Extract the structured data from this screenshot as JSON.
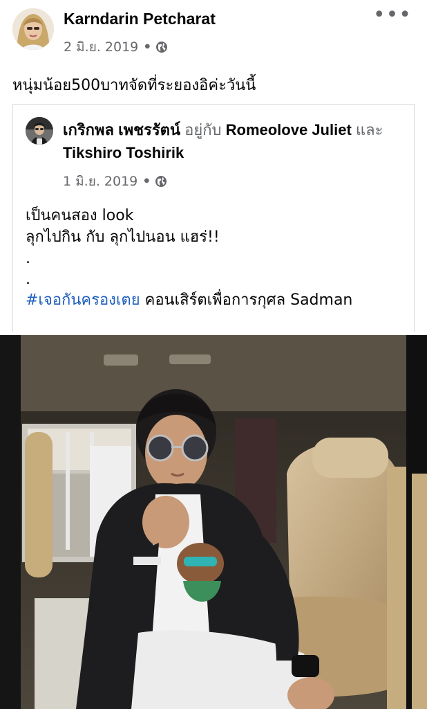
{
  "post": {
    "author": "Karndarin Petcharat",
    "date": "2 มิ.ย. 2019",
    "dot": "•",
    "caption": "หนุ่มน้อย500บาทจัดที่ระยองอิค่ะวันนี้",
    "more_icon": "more-horizontal-icon",
    "privacy_icon": "globe-icon"
  },
  "shared": {
    "author": "เกริกพล เพชรรัตน์",
    "with_text": "อยู่กับ",
    "tag1": "Romeolove Juliet",
    "and_text": "และ",
    "tag2": "Tikshiro Toshirik",
    "date": "1 มิ.ย. 2019",
    "dot": "•",
    "lines": [
      "เป็นคนสอง look",
      "ลุกไปกิน กับ ลุกไปนอน แฮร่!!",
      ".",
      "."
    ],
    "hashtag": "#เจอกันครองเตย",
    "last_line_rest": " คอนเสิร์ตเพื่อการกุศล Sadman",
    "privacy_icon": "globe-icon"
  },
  "colors": {
    "link": "#1f5fbf",
    "muted": "#65676b",
    "text": "#050505",
    "border": "#d9dadd"
  }
}
